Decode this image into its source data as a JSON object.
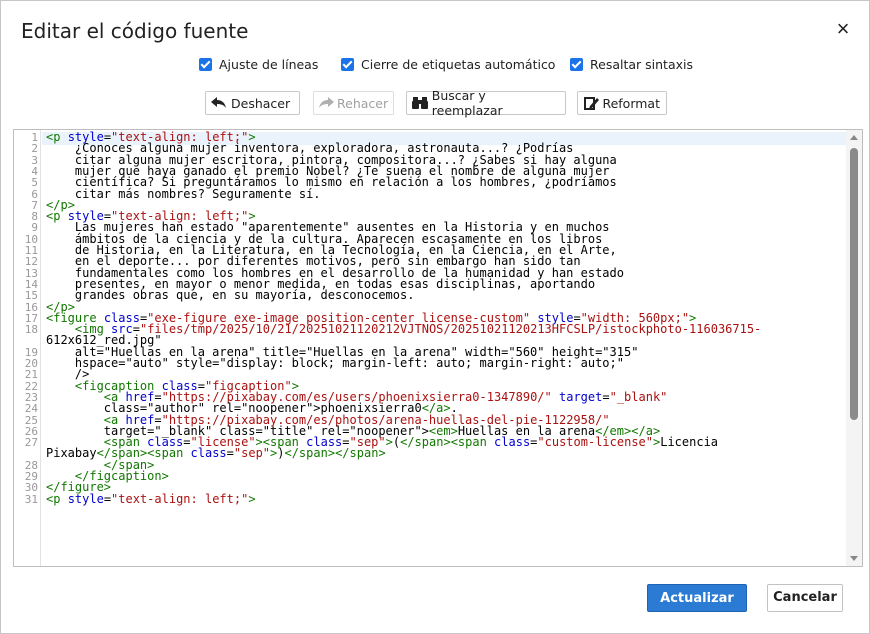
{
  "dialog": {
    "title": "Editar el código fuente",
    "close_label": "×"
  },
  "options": [
    {
      "label": "Ajuste de líneas",
      "checked": true
    },
    {
      "label": "Cierre de etiquetas automático",
      "checked": true
    },
    {
      "label": "Resaltar sintaxis",
      "checked": true
    }
  ],
  "toolbar": {
    "undo_label": "Deshacer",
    "redo_label": "Rehacer",
    "search_label": "Buscar y reemplazar",
    "reformat_label": "Reformat"
  },
  "editor": {
    "lines": [
      {
        "n": "1",
        "text": "<p style=\"text-align: left;\">"
      },
      {
        "n": "2",
        "text": "    ¿Conoces alguna mujer inventora, exploradora, astronauta...? ¿Podrías"
      },
      {
        "n": "3",
        "text": "    citar alguna mujer escritora, pintora, compositora...? ¿Sabes si hay alguna"
      },
      {
        "n": "4",
        "text": "    mujer que haya ganado el premio Nobel? ¿Te suena el nombre de alguna mujer"
      },
      {
        "n": "5",
        "text": "    científica? Si preguntáramos lo mismo en relación a los hombres, ¿podríamos"
      },
      {
        "n": "6",
        "text": "    citar más nombres? Seguramente sí."
      },
      {
        "n": "7",
        "text": "</p>"
      },
      {
        "n": "8",
        "text": "<p style=\"text-align: left;\">"
      },
      {
        "n": "9",
        "text": "    Las mujeres han estado \"aparentemente\" ausentes en la Historia y en muchos"
      },
      {
        "n": "10",
        "text": "    ámbitos de la ciencia y de la cultura. Aparecen escasamente en los libros"
      },
      {
        "n": "11",
        "text": "    de Historia, en la Literatura, en la Tecnología, en la Ciencia, en el Arte,"
      },
      {
        "n": "12",
        "text": "    en el deporte... por diferentes motivos, pero sin embargo han sido tan"
      },
      {
        "n": "13",
        "text": "    fundamentales como los hombres en el desarrollo de la humanidad y han estado"
      },
      {
        "n": "14",
        "text": "    presentes, en mayor o menor medida, en todas esas disciplinas, aportando"
      },
      {
        "n": "15",
        "text": "    grandes obras que, en su mayoría, desconocemos."
      },
      {
        "n": "16",
        "text": "</p>"
      },
      {
        "n": "17",
        "text": "<figure class=\"exe-figure exe-image position-center license-custom\" style=\"width: 560px;\">"
      },
      {
        "n": "18",
        "text": "    <img src=\"files/tmp/2025/10/21/20251021120212VJTNOS/20251021120213HFCSLP/istockphoto-116036715-"
      },
      {
        "n": "",
        "text": "612x612_red.jpg\""
      },
      {
        "n": "19",
        "text": "    alt=\"Huellas en la arena\" title=\"Huellas en la arena\" width=\"560\" height=\"315\""
      },
      {
        "n": "20",
        "text": "    hspace=\"auto\" style=\"display: block; margin-left: auto; margin-right: auto;\""
      },
      {
        "n": "21",
        "text": "    />"
      },
      {
        "n": "22",
        "text": "    <figcaption class=\"figcaption\">"
      },
      {
        "n": "23",
        "text": "        <a href=\"https://pixabay.com/es/users/phoenixsierra0-1347890/\" target=\"_blank\""
      },
      {
        "n": "24",
        "text": "        class=\"author\" rel=\"noopener\">phoenixsierra0</a>."
      },
      {
        "n": "25",
        "text": "        <a href=\"https://pixabay.com/es/photos/arena-huellas-del-pie-1122958/\""
      },
      {
        "n": "26",
        "text": "        target=\"_blank\" class=\"title\" rel=\"noopener\"><em>Huellas en la arena</em></a>"
      },
      {
        "n": "27",
        "text": "        <span class=\"license\"><span class=\"sep\">(</span><span class=\"custom-license\">Licencia"
      },
      {
        "n": "",
        "text": "Pixabay</span><span class=\"sep\">)</span></span>"
      },
      {
        "n": "28",
        "text": "        </span>"
      },
      {
        "n": "29",
        "text": "    </figcaption>"
      },
      {
        "n": "30",
        "text": "</figure>"
      },
      {
        "n": "31",
        "text": "<p style=\"text-align: left;\">"
      }
    ]
  },
  "footer": {
    "update_label": "Actualizar",
    "cancel_label": "Cancelar"
  },
  "colors": {
    "primary": "#2b7bd5",
    "checkbox": "#1a73e8",
    "tag": "#117700",
    "attr": "#0000cc",
    "string": "#aa1111"
  }
}
